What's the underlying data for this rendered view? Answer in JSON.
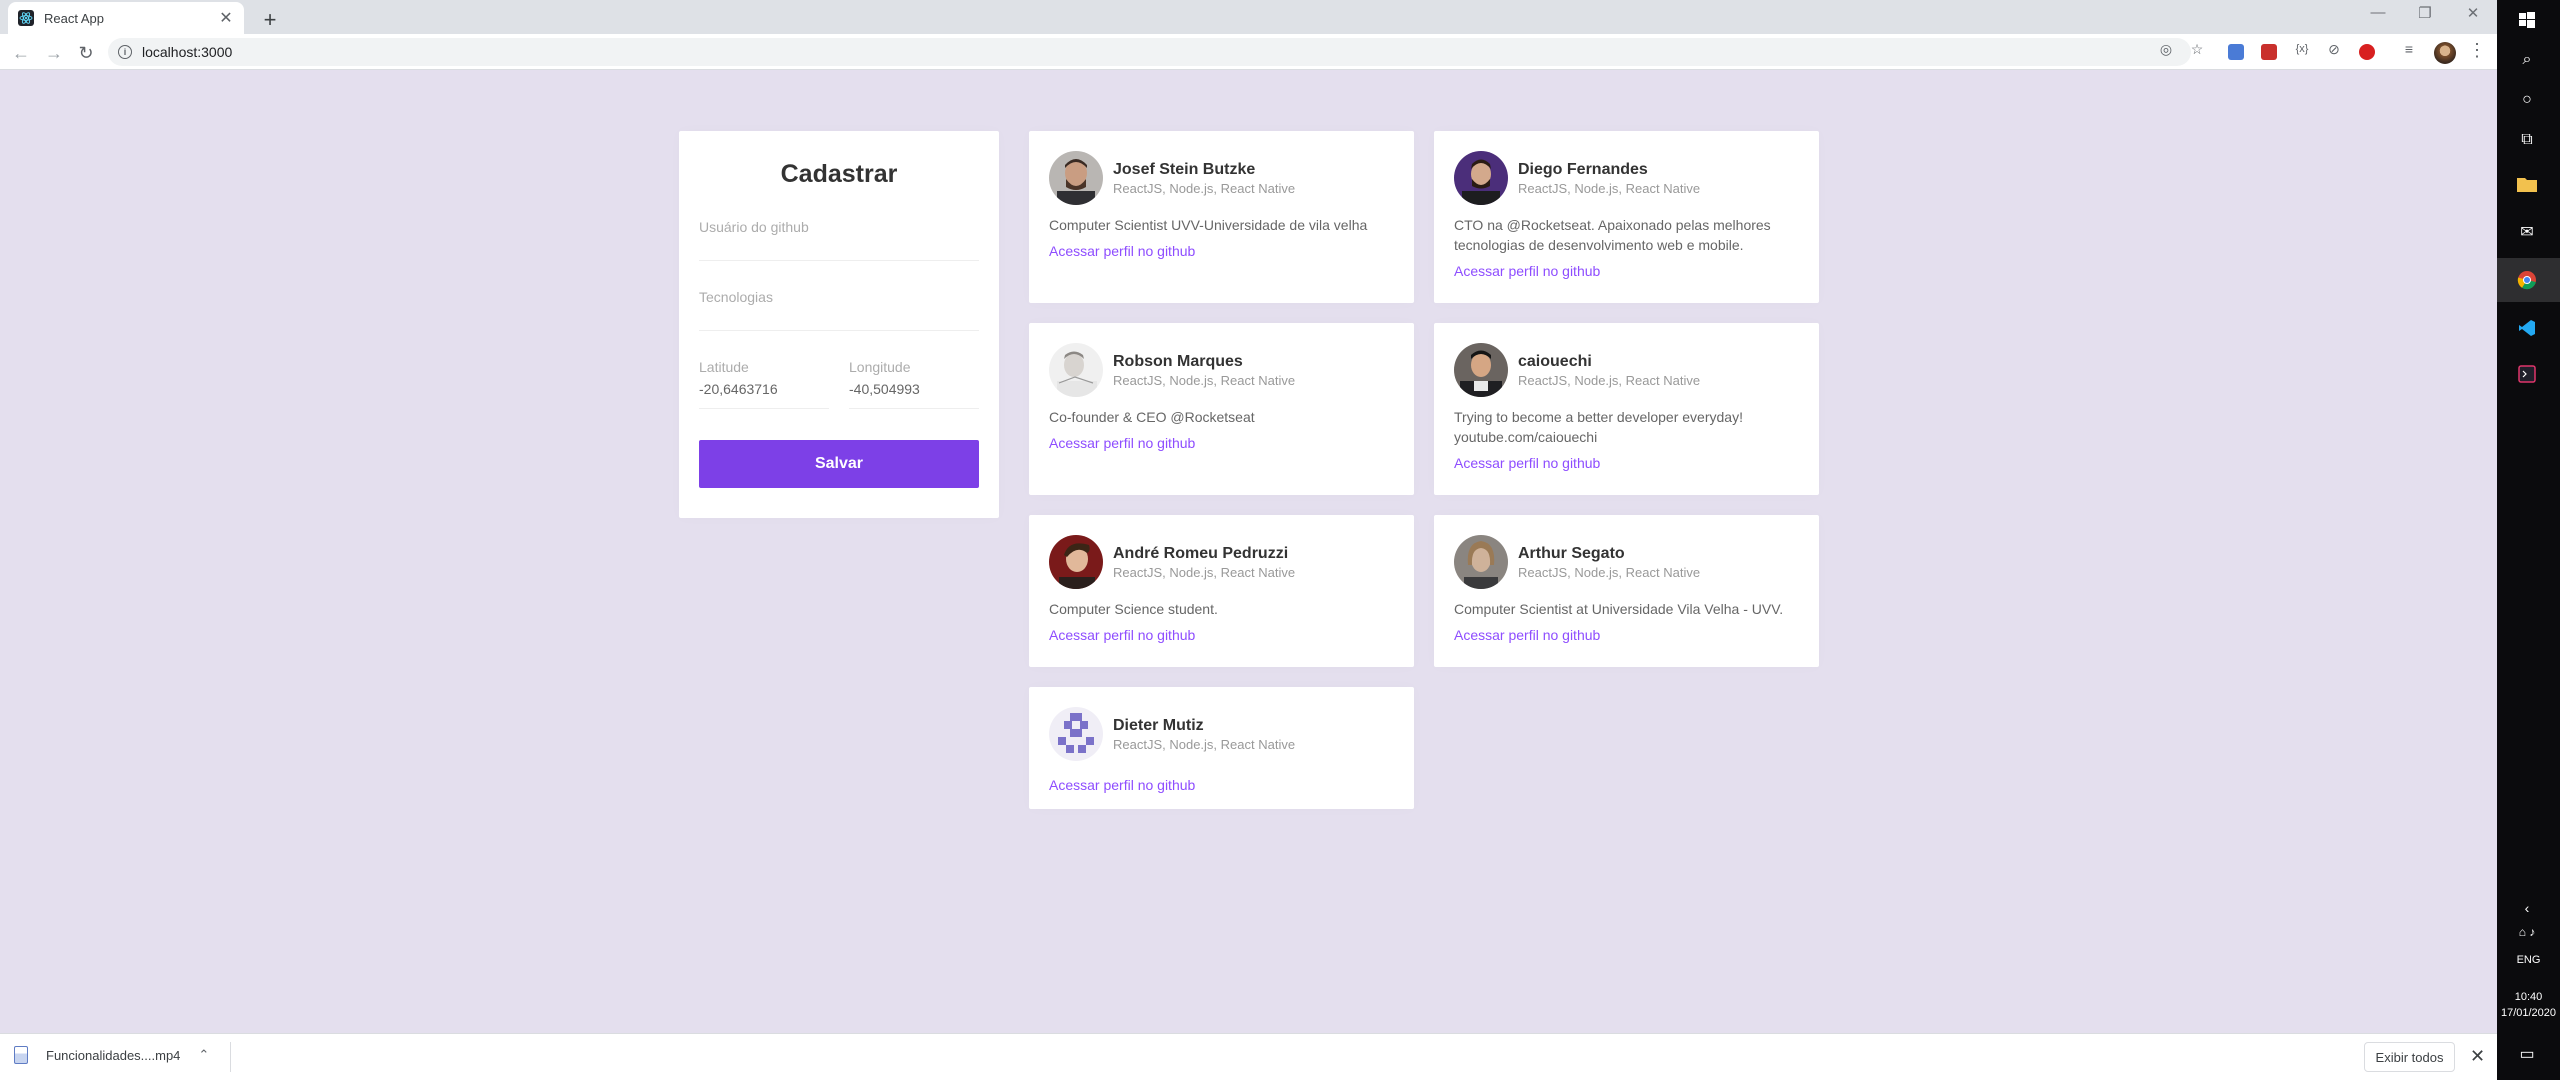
{
  "browser": {
    "tab_title": "React App",
    "tab_close": "✕",
    "new_tab": "+",
    "url": "localhost:3000",
    "win_minimize": "—",
    "win_restore": "❐",
    "win_close": "✕"
  },
  "form": {
    "title": "Cadastrar",
    "github_user_label": "Usuário do github",
    "techs_label": "Tecnologias",
    "latitude_label": "Latitude",
    "latitude_value": "-20,6463716",
    "longitude_label": "Longitude",
    "longitude_value": "-40,504993",
    "submit_label": "Salvar"
  },
  "colors": {
    "page_background": "#e4dfee",
    "accent": "#7d40e7",
    "link": "#8e4dff"
  },
  "devs": [
    {
      "name": "Josef Stein Butzke",
      "techs": "ReactJS, Node.js, React Native",
      "bio": "Computer Scientist UVV-Universidade de vila velha",
      "link": "Acessar perfil no github"
    },
    {
      "name": "Diego Fernandes",
      "techs": "ReactJS, Node.js, React Native",
      "bio": "CTO na @Rocketseat. Apaixonado pelas melhores tecnologias de desenvolvimento web e mobile.",
      "link": "Acessar perfil no github"
    },
    {
      "name": "Robson Marques",
      "techs": "ReactJS, Node.js, React Native",
      "bio": "Co-founder & CEO @Rocketseat",
      "link": "Acessar perfil no github"
    },
    {
      "name": "caiouechi",
      "techs": "ReactJS, Node.js, React Native",
      "bio": "Trying to become a better developer everyday! youtube.com/caiouechi",
      "link": "Acessar perfil no github"
    },
    {
      "name": "André Romeu Pedruzzi",
      "techs": "ReactJS, Node.js, React Native",
      "bio": "Computer Science student.",
      "link": "Acessar perfil no github"
    },
    {
      "name": "Arthur Segato",
      "techs": "ReactJS, Node.js, React Native",
      "bio": "Computer Scientist at Universidade Vila Velha - UVV.",
      "link": "Acessar perfil no github"
    },
    {
      "name": "Dieter Mutiz",
      "techs": "ReactJS, Node.js, React Native",
      "bio": "",
      "link": "Acessar perfil no github"
    }
  ],
  "download_bar": {
    "file_name": "Funcionalidades....mp4",
    "show_all": "Exibir todos",
    "close": "✕"
  },
  "taskbar": {
    "language": "ENG",
    "time": "10:40",
    "date": "17/01/2020"
  }
}
